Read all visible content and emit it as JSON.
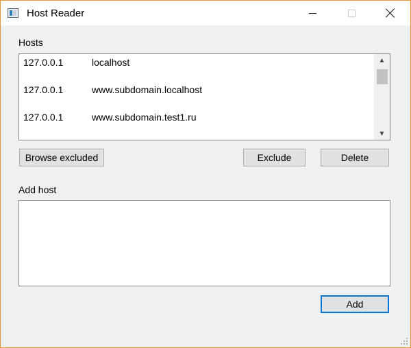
{
  "window": {
    "title": "Host Reader",
    "accent_border": "#e8962e"
  },
  "hosts": {
    "label": "Hosts",
    "rows": [
      {
        "ip": "127.0.0.1",
        "name": "localhost"
      },
      {
        "ip": "127.0.0.1",
        "name": "www.subdomain.localhost"
      },
      {
        "ip": "127.0.0.1",
        "name": "www.subdomain.test1.ru"
      }
    ]
  },
  "buttons": {
    "browse_excluded": "Browse excluded",
    "exclude": "Exclude",
    "delete": "Delete",
    "add": "Add"
  },
  "add_host": {
    "label": "Add host",
    "value": ""
  },
  "icons": {
    "app": "app-icon",
    "minimize": "minimize-icon",
    "maximize": "maximize-icon",
    "close": "close-icon",
    "scroll_up": "chevron-up-icon",
    "scroll_down": "chevron-down-icon",
    "resize_grip": "resize-grip-icon"
  }
}
